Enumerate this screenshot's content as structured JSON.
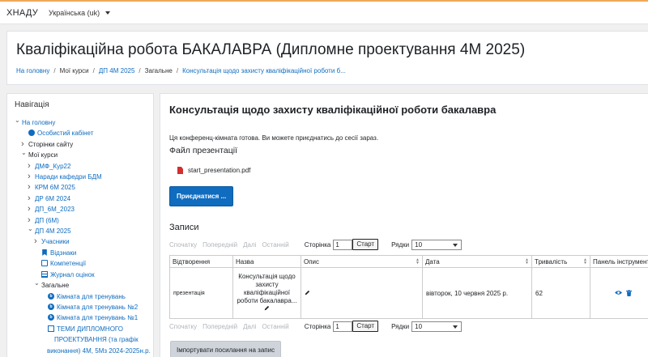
{
  "topbar": {
    "brand": "ХНАДУ",
    "language": "Українська (uk)"
  },
  "header": {
    "title": "Кваліфікаційна робота БАКАЛАВРА (Дипломне проектування 4М 2025)",
    "breadcrumb": [
      "На головну",
      "Мої курси",
      "ДП 4М 2025",
      "Загальне",
      "Консультація щодо захисту кваліфікаційної роботи б..."
    ]
  },
  "navigation": {
    "title": "Навігація",
    "items": [
      {
        "label": "На головну",
        "chev": "v",
        "indent": 0,
        "link": true,
        "icon": ""
      },
      {
        "label": "Особистий кабінет",
        "chev": "",
        "indent": 1,
        "link": true,
        "icon": "dashboard-icon"
      },
      {
        "label": "Сторінки сайту",
        "chev": ">",
        "indent": 1,
        "link": false,
        "icon": ""
      },
      {
        "label": "Мої курси",
        "chev": "v",
        "indent": 1,
        "link": false,
        "icon": ""
      },
      {
        "label": "ДМФ_Кур22",
        "chev": ">",
        "indent": 2,
        "link": true,
        "icon": ""
      },
      {
        "label": "Наради кафедри БДМ",
        "chev": ">",
        "indent": 2,
        "link": true,
        "icon": ""
      },
      {
        "label": "КРМ 6М 2025",
        "chev": ">",
        "indent": 2,
        "link": true,
        "icon": ""
      },
      {
        "label": "ДР 6М 2024",
        "chev": ">",
        "indent": 2,
        "link": true,
        "icon": ""
      },
      {
        "label": "ДП_6М_2023",
        "chev": ">",
        "indent": 2,
        "link": true,
        "icon": ""
      },
      {
        "label": "ДП (6М)",
        "chev": ">",
        "indent": 2,
        "link": true,
        "icon": ""
      },
      {
        "label": "ДП 4М 2025",
        "chev": "v",
        "indent": 2,
        "link": true,
        "icon": ""
      },
      {
        "label": "Учасники",
        "chev": ">",
        "indent": 3,
        "link": true,
        "icon": ""
      },
      {
        "label": "Відзнаки",
        "chev": "",
        "indent": 3,
        "link": true,
        "icon": "badge-icon"
      },
      {
        "label": "Компетенції",
        "chev": "",
        "indent": 3,
        "link": true,
        "icon": "checkbox-icon"
      },
      {
        "label": "Журнал оцінок",
        "chev": "",
        "indent": 3,
        "link": true,
        "icon": "gradebook-icon"
      },
      {
        "label": "Загальне",
        "chev": "v",
        "indent": 3,
        "link": false,
        "icon": ""
      },
      {
        "label": "Кімната для тренувань",
        "chev": "",
        "indent": 4,
        "link": true,
        "icon": "bigbluebutton-icon"
      },
      {
        "label": "Кімната для тренувань №2",
        "chev": "",
        "indent": 4,
        "link": true,
        "icon": "bigbluebutton-icon"
      },
      {
        "label": "Кімната для тренувань №1",
        "chev": "",
        "indent": 4,
        "link": true,
        "icon": "bigbluebutton-icon"
      },
      {
        "label": "ТЕМИ ДИПЛОМНОГО",
        "chev": "",
        "indent": 4,
        "link": true,
        "icon": "document-icon"
      },
      {
        "label": "ПРОЕКТУВАННЯ (та графік",
        "chev": "",
        "indent": 5,
        "link": true,
        "icon": ""
      },
      {
        "label": "виконання) 4М, 5Мз 2024-2025н.р.",
        "chev": "",
        "indent": 5,
        "link": true,
        "icon": ""
      },
      {
        "label": "",
        "chev": "",
        "indent": 4,
        "link": true,
        "icon": "pdf-icon"
      }
    ]
  },
  "main": {
    "title": "Консультація щодо захисту кваліфікаційної роботи бакалавра",
    "status": "Ця конференц-кімната готова. Ви можете приєднатись до сесії зараз.",
    "presentation_heading": "Файл презентації",
    "presentation_file": "start_presentation.pdf",
    "join_button": "Приєднатися ...",
    "records_heading": "Записи",
    "pager": {
      "first": "Спочатку",
      "prev": "Попередній",
      "next": "Далі",
      "last": "Останній",
      "page_label": "Сторінка",
      "page_value": "1",
      "start_button": "Старт",
      "rows_label": "Рядки",
      "rows_value": "10"
    },
    "table": {
      "headers": [
        "Відтворення",
        "Назва",
        "Опис",
        "Дата",
        "Тривалість",
        "Панель інструментів"
      ],
      "rows": [
        {
          "playback": "презентація",
          "name": "Консультація щодо захисту кваліфікаційної роботи бакалавра...",
          "description": "",
          "date": "вівторок, 10 червня 2025 р.",
          "duration": "62"
        }
      ]
    },
    "import_button": "Імпортувати посилання на запис"
  }
}
